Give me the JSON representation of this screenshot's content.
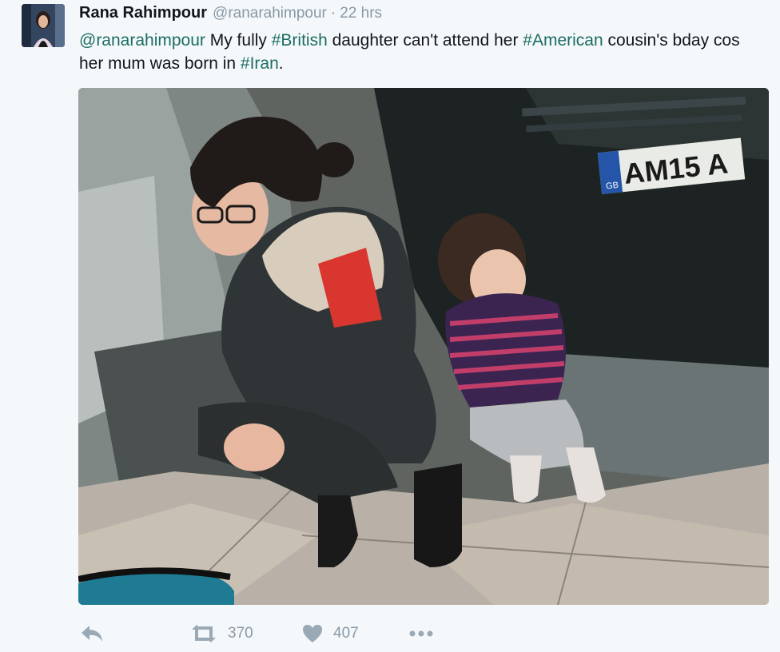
{
  "tweet": {
    "display_name": "Rana Rahimpour",
    "handle": "@ranarahimpour",
    "separator": "·",
    "time": "22 hrs",
    "text_parts": {
      "mention": "@ranarahimpour",
      "t1": " My fully ",
      "h1": "#British",
      "t2": " daughter can't attend her ",
      "h2": "#American",
      "t3": " cousin's bday cos her mum was born in ",
      "h3": "#Iran",
      "t4": "."
    },
    "image": {
      "plate_text": "AM15 A",
      "plate_country": "GB"
    }
  },
  "actions": {
    "reply_icon": "reply-icon",
    "retweet_icon": "retweet-icon",
    "retweet_count": "370",
    "like_icon": "heart-icon",
    "like_count": "407",
    "more_icon": "more-icon"
  },
  "colors": {
    "hashtag": "#1b6d62",
    "meta_text": "#8899a6",
    "icon": "#9aa9b6",
    "background": "#f5f8fa"
  }
}
